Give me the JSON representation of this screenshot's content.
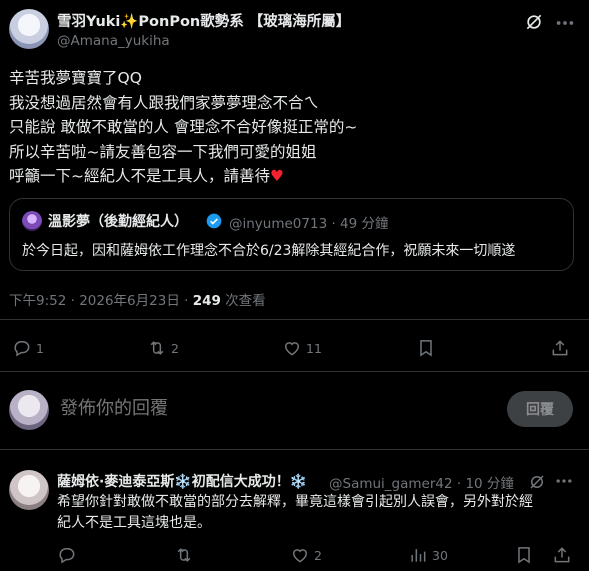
{
  "tweet": {
    "author_name": "雪羽Yuki✨PonPon歌勢系 【玻璃海所屬】",
    "author_handle": "@Amana_yukiha",
    "lines": [
      "辛苦我夢寶寶了QQ",
      "我没想過居然會有人跟我們家夢夢理念不合ㄟ",
      "只能說 敢做不敢當的人 會理念不合好像挺正常的~",
      "所以辛苦啦~請友善包容一下我們可愛的姐姐",
      "呼籲一下~經紀人不是工具人，請善待"
    ],
    "heart_emoji": "♥",
    "timestamp": "下午9:52 · 2026年6月23日 · ",
    "views_count": "249",
    "views_label": " 次查看",
    "reply_count": "1",
    "retweet_count": "2",
    "like_count": "11"
  },
  "quote": {
    "name": "溫影夢（後勤經紀人）",
    "handle_time": "@inyume0713 · 49 分鐘",
    "text": "於今日起，因和薩姆依工作理念不合於6/23解除其經紀合作，祝願未來一切順遂"
  },
  "compose": {
    "placeholder": "發佈你的回覆",
    "button_label": "回覆"
  },
  "reply": {
    "name": "薩姆依·麥迪泰亞斯❄️初配信大成功！❄️",
    "handle_time": "@Samui_gamer42 · 10 分鐘",
    "lines": [
      "希望你針對敢做不敢當的部分去解釋，畢竟這樣會引起別人誤會，另外對於經",
      "紀人不是工具這塊也是。"
    ],
    "like_count": "2",
    "views_count": "30"
  },
  "colors": {
    "background": "#000000",
    "text": "#e7e9ea",
    "muted": "#71767b",
    "divider": "#2f3336",
    "verified": "#1d9bf0",
    "heart": "#f4212e"
  }
}
